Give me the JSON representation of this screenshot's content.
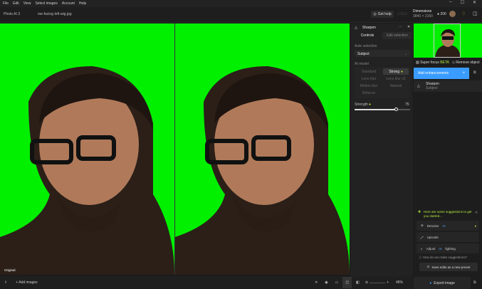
{
  "menu": [
    "File",
    "Edit",
    "View",
    "Select images",
    "Account",
    "Help"
  ],
  "app_title": "Photo AI 3",
  "file_name": "me-facing-left-wig.jpg",
  "header": {
    "get_help": "Get help",
    "faded_label": "LOGS",
    "dimensions_label": "Dimensions",
    "dimensions_value": "3840 × 2160",
    "credits": "200"
  },
  "canvas": {
    "original_label": "Original",
    "background_color": "#00f000"
  },
  "bottombar": {
    "add_images": "Add images",
    "zoom": "46%"
  },
  "panel": {
    "title": "Sharpen",
    "tabs": [
      "Controls",
      "Edit selection"
    ],
    "auto_selection_label": "Auto selection",
    "auto_selection_value": "Subject",
    "ai_model_label": "AI model",
    "models": [
      "Standard",
      "Strong",
      "Lens blur",
      "Lens blur v2",
      "Motion blur",
      "Natural",
      "Refocus"
    ],
    "selected_model": "Strong",
    "strength_label": "Strength",
    "strength_value": "75",
    "strength_fraction": 0.75
  },
  "right": {
    "super_focus": "Super focus",
    "beta": "BETA",
    "remove_object": "Remove object",
    "add_enhancements": "Add enhancements",
    "enh_name": "Sharpen",
    "enh_sub": "Subject",
    "suggestions_title": "Here are some suggestions to get you started...",
    "suggestions": [
      {
        "pre": "Denoise",
        "ai": "AI",
        "post": ""
      },
      {
        "pre": "Upscale",
        "ai": "",
        "post": ""
      },
      {
        "pre": "Adjust",
        "ai": "AI",
        "post": "lighting"
      }
    ],
    "how_link": "How do we make suggestions?",
    "save_preset": "Save edits as a new preset",
    "export": "Export image"
  },
  "colors": {
    "accent": "#3b9cff",
    "green": "#b6f23a",
    "screen_green": "#00f000"
  }
}
